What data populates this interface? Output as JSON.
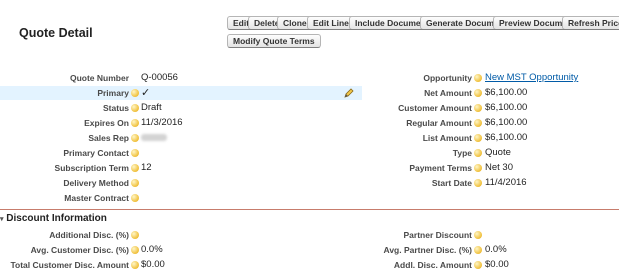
{
  "page": {
    "title": "Quote Detail"
  },
  "buttons": {
    "edit": "Edit",
    "delete": "Delete",
    "clone": "Clone",
    "edit_lines": "Edit Lines",
    "include_document": "Include Document",
    "generate_document": "Generate Document",
    "preview_document": "Preview Document",
    "refresh_prices": "Refresh Prices",
    "modify_quote_terms": "Modify Quote Terms"
  },
  "left_fields": {
    "quote_number": {
      "label": "Quote Number",
      "value": "Q-00056"
    },
    "primary": {
      "label": "Primary",
      "value": "✓"
    },
    "status": {
      "label": "Status",
      "value": "Draft"
    },
    "expires_on": {
      "label": "Expires On",
      "value": "11/3/2016"
    },
    "sales_rep": {
      "label": "Sales Rep",
      "value": ""
    },
    "primary_contact": {
      "label": "Primary Contact",
      "value": ""
    },
    "subscription_term": {
      "label": "Subscription Term",
      "value": "12"
    },
    "delivery_method": {
      "label": "Delivery Method",
      "value": ""
    },
    "master_contract": {
      "label": "Master Contract",
      "value": ""
    }
  },
  "right_fields": {
    "opportunity": {
      "label": "Opportunity",
      "value": "New MST Opportunity"
    },
    "net_amount": {
      "label": "Net Amount",
      "value": "$6,100.00"
    },
    "customer_amount": {
      "label": "Customer Amount",
      "value": "$6,100.00"
    },
    "regular_amount": {
      "label": "Regular Amount",
      "value": "$6,100.00"
    },
    "list_amount": {
      "label": "List Amount",
      "value": "$6,100.00"
    },
    "type": {
      "label": "Type",
      "value": "Quote"
    },
    "payment_terms": {
      "label": "Payment Terms",
      "value": "Net 30"
    },
    "start_date": {
      "label": "Start Date",
      "value": "11/4/2016"
    }
  },
  "discount_section": {
    "title": "Discount Information",
    "left": {
      "additional_disc": {
        "label": "Additional Disc. (%)",
        "value": ""
      },
      "avg_customer_disc": {
        "label": "Avg. Customer Disc. (%)",
        "value": "0.0%"
      },
      "total_customer_disc_amount": {
        "label": "Total Customer Disc. Amount",
        "value": "$0.00"
      }
    },
    "right": {
      "partner_discount": {
        "label": "Partner Discount",
        "value": ""
      },
      "avg_partner_disc": {
        "label": "Avg. Partner Disc. (%)",
        "value": "0.0%"
      },
      "addl_disc_amount": {
        "label": "Addl. Disc. Amount",
        "value": "$0.00"
      }
    }
  },
  "colors": {
    "link": "#015ba7",
    "primary_row_bg": "#e3f3ff",
    "section_rule": "#c77c6c"
  }
}
